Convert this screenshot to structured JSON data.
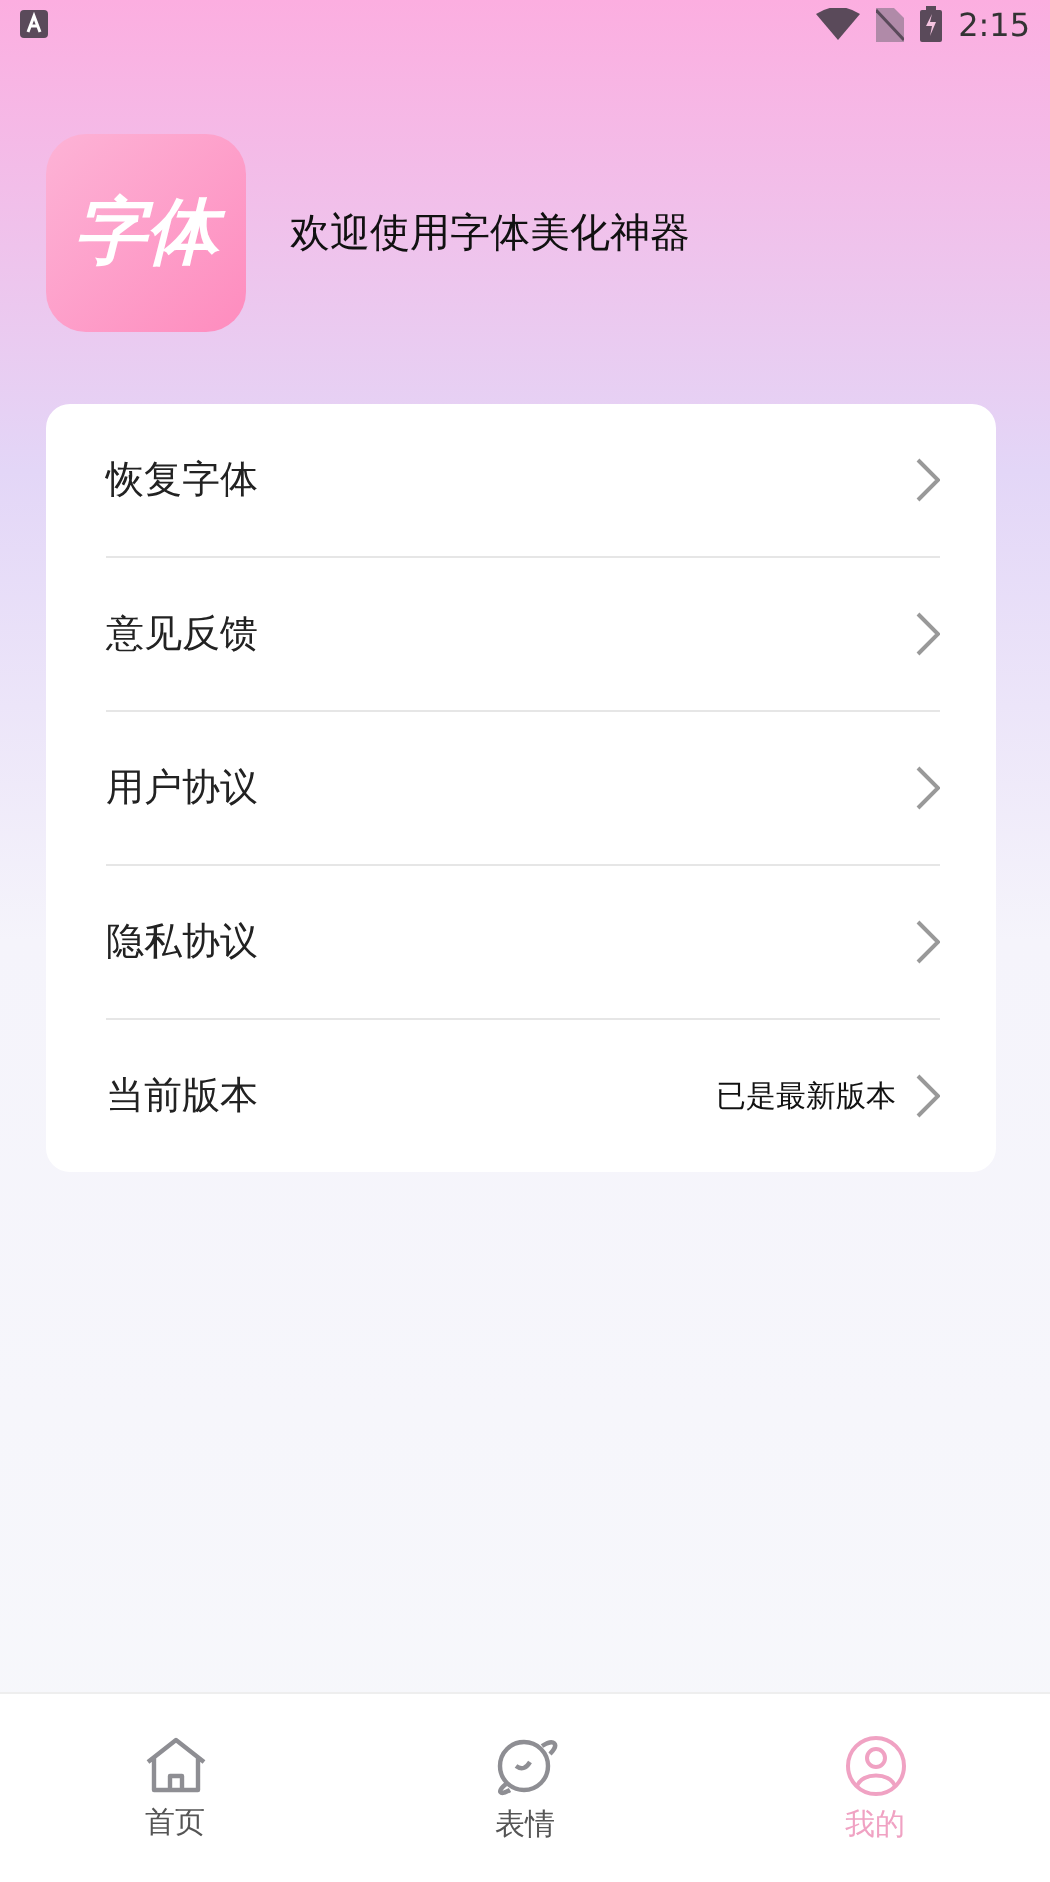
{
  "status_bar": {
    "time": "2:15"
  },
  "header": {
    "logo_text": "字体",
    "welcome": "欢迎使用字体美化神器"
  },
  "menu": [
    {
      "label": "恢复字体"
    },
    {
      "label": "意见反馈"
    },
    {
      "label": "用户协议"
    },
    {
      "label": "隐私协议"
    },
    {
      "label": "当前版本",
      "value": "已是最新版本"
    }
  ],
  "tabs": [
    {
      "label": "首页",
      "kind": "home",
      "selected": false
    },
    {
      "label": "表情",
      "kind": "planet",
      "selected": false
    },
    {
      "label": "我的",
      "kind": "user",
      "selected": true
    }
  ]
}
